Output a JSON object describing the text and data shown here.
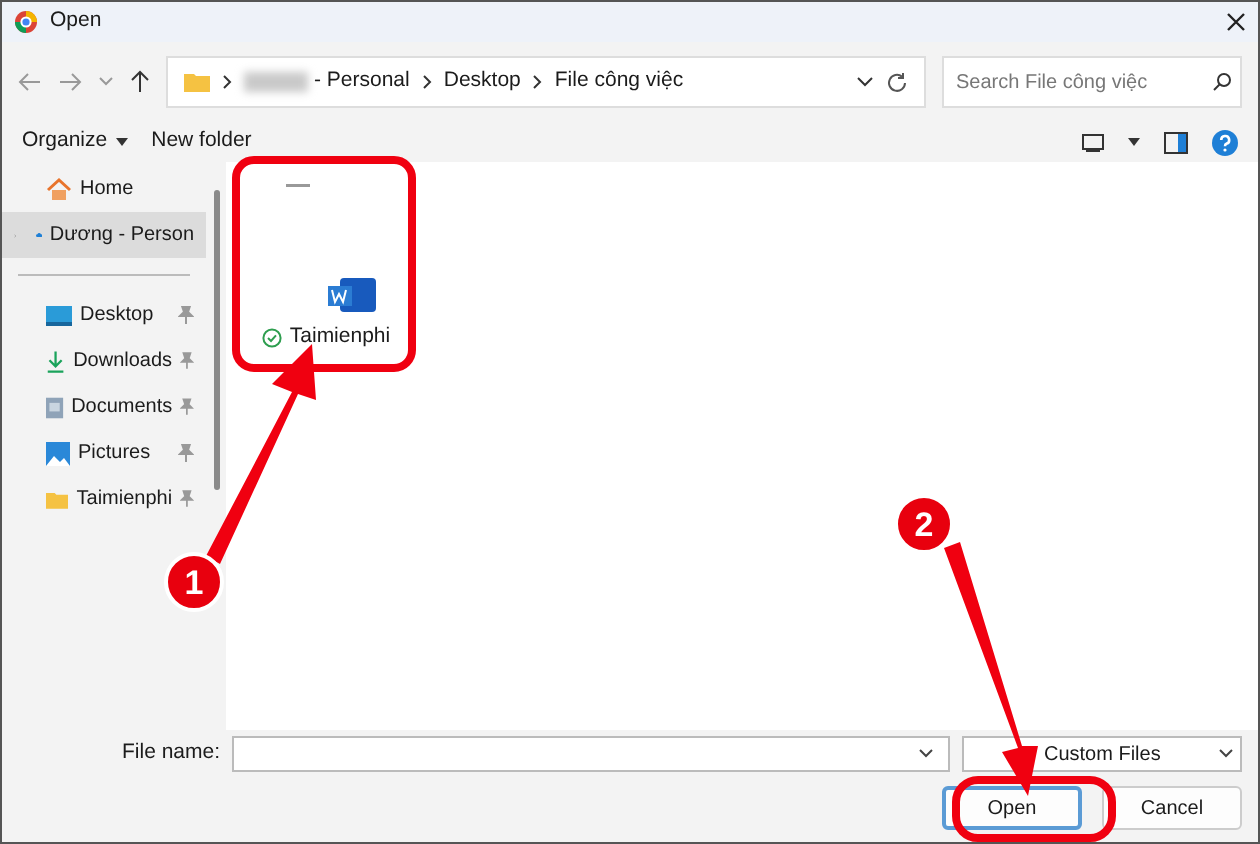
{
  "window": {
    "title": "Open"
  },
  "address": {
    "segments": [
      "- Personal",
      "Desktop",
      "File công việc"
    ],
    "redacted_first": true
  },
  "search": {
    "placeholder": "Search File công việc"
  },
  "toolbar": {
    "organize": "Organize",
    "new_folder": "New folder"
  },
  "sidebar": {
    "items": [
      {
        "label": "Home",
        "kind": "home",
        "selected": false,
        "pinned": false
      },
      {
        "label": "Dương - Person",
        "kind": "cloud",
        "selected": true,
        "pinned": false
      },
      {
        "label": "Desktop",
        "kind": "desktop",
        "selected": false,
        "pinned": true
      },
      {
        "label": "Downloads",
        "kind": "download",
        "selected": false,
        "pinned": true
      },
      {
        "label": "Documents",
        "kind": "documents",
        "selected": false,
        "pinned": true
      },
      {
        "label": "Pictures",
        "kind": "pictures",
        "selected": false,
        "pinned": true
      },
      {
        "label": "Taimienphi",
        "kind": "folder",
        "selected": false,
        "pinned": true
      }
    ]
  },
  "files": [
    {
      "name": "Taimienphi",
      "synced": true
    }
  ],
  "file_name": {
    "label": "File name:"
  },
  "file_type": {
    "value": "Custom Files"
  },
  "buttons": [
    {
      "label": "Open",
      "default": true
    },
    {
      "label": "Cancel",
      "default": false
    }
  ],
  "annotations": [
    {
      "number": "1"
    },
    {
      "number": "2"
    }
  ]
}
